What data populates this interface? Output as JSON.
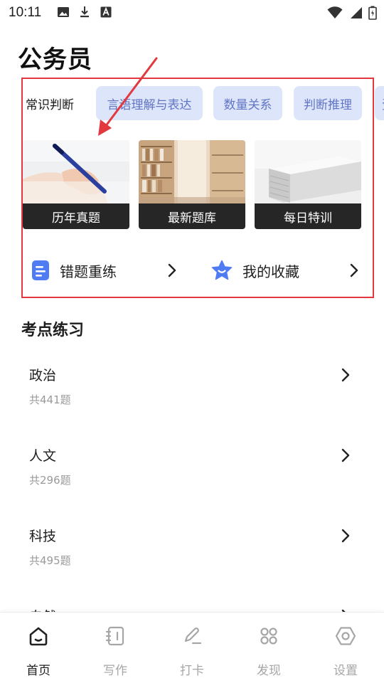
{
  "status_bar": {
    "time": "10:11"
  },
  "page": {
    "title": "公务员"
  },
  "tabs": [
    {
      "label": "常识判断",
      "active": true
    },
    {
      "label": "言语理解与表达",
      "active": false
    },
    {
      "label": "数量关系",
      "active": false
    },
    {
      "label": "判断推理",
      "active": false
    },
    {
      "label": "资",
      "active": false
    }
  ],
  "cards": [
    {
      "label": "历年真题",
      "image": "writing-hand-photo"
    },
    {
      "label": "最新题库",
      "image": "library-shelves-photo"
    },
    {
      "label": "每日特训",
      "image": "stacked-papers-photo"
    }
  ],
  "quick_links": [
    {
      "label": "错题重练",
      "icon": "document-icon"
    },
    {
      "label": "我的收藏",
      "icon": "star-icon"
    }
  ],
  "section": {
    "title": "考点练习",
    "items": [
      {
        "title": "政治",
        "count": "共441题"
      },
      {
        "title": "人文",
        "count": "共296题"
      },
      {
        "title": "科技",
        "count": "共495题"
      },
      {
        "title": "自然",
        "count": ""
      }
    ]
  },
  "bottom_nav": [
    {
      "label": "首页",
      "icon": "home-icon",
      "active": true
    },
    {
      "label": "写作",
      "icon": "notebook-icon",
      "active": false
    },
    {
      "label": "打卡",
      "icon": "pen-icon",
      "active": false
    },
    {
      "label": "发现",
      "icon": "grid-icon",
      "active": false
    },
    {
      "label": "设置",
      "icon": "settings-icon",
      "active": false
    }
  ],
  "colors": {
    "accent_pill_bg": "#dde5fb",
    "accent_pill_text": "#6175c4",
    "highlight_red": "#e1393f",
    "icon_blue": "#4f7cf3"
  }
}
